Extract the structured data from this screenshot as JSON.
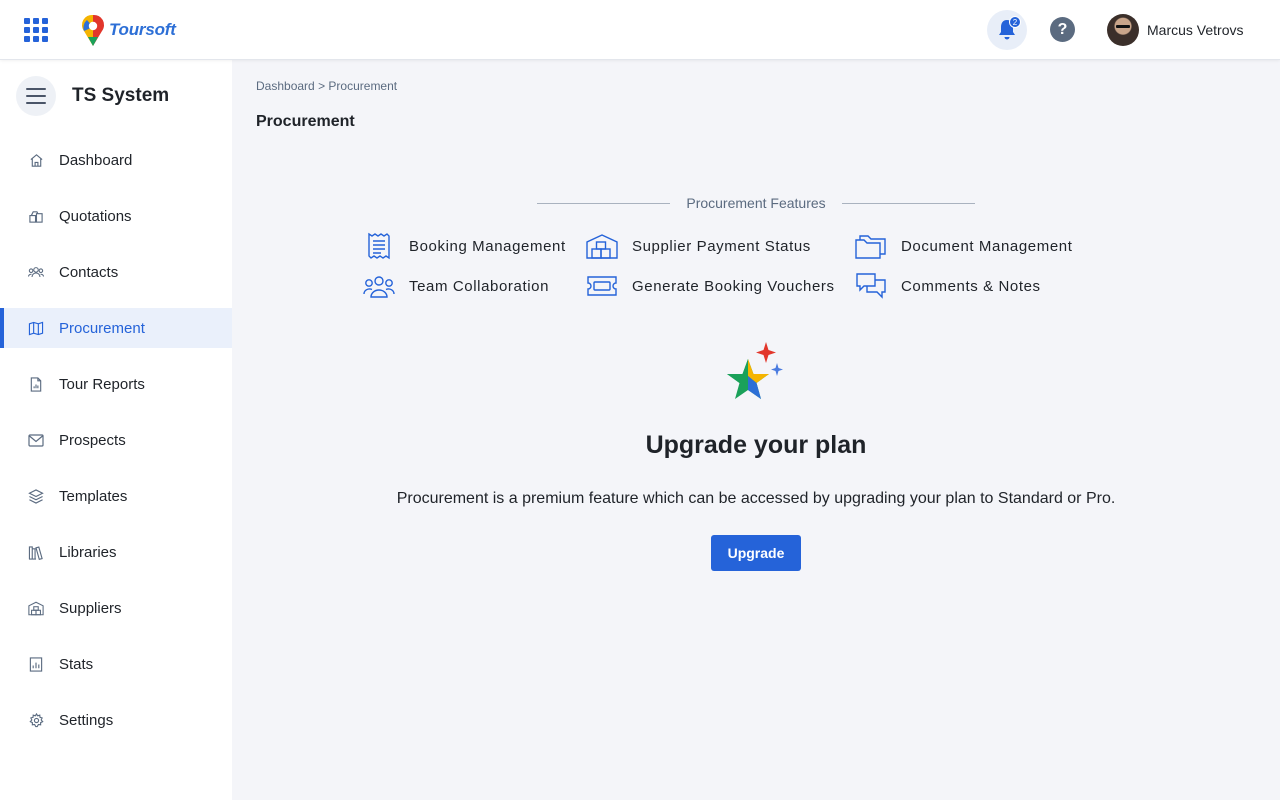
{
  "app": {
    "logo_text": "Toursoft",
    "apps_icon": "grid-icon",
    "brand_color": "#2563d9"
  },
  "topbar": {
    "notifications_count": "2",
    "help_label": "?",
    "user_name": "Marcus Vetrovs"
  },
  "sidebar": {
    "title": "TS System",
    "items": [
      {
        "label": "Dashboard",
        "icon": "home-icon"
      },
      {
        "label": "Quotations",
        "icon": "quotations-icon"
      },
      {
        "label": "Contacts",
        "icon": "contacts-icon"
      },
      {
        "label": "Procurement",
        "icon": "map-icon",
        "active": true
      },
      {
        "label": "Tour Reports",
        "icon": "report-icon"
      },
      {
        "label": "Prospects",
        "icon": "mail-icon"
      },
      {
        "label": "Templates",
        "icon": "layers-icon"
      },
      {
        "label": "Libraries",
        "icon": "books-icon"
      },
      {
        "label": "Suppliers",
        "icon": "warehouse-icon"
      },
      {
        "label": "Stats",
        "icon": "stats-icon"
      },
      {
        "label": "Settings",
        "icon": "gear-icon"
      }
    ]
  },
  "main": {
    "breadcrumb": {
      "root": "Dashboard",
      "separator": ">",
      "current": "Procurement"
    },
    "title": "Procurement",
    "features_heading": "Procurement Features",
    "features": [
      {
        "label": "Booking Management",
        "icon": "receipt-icon"
      },
      {
        "label": "Supplier Payment Status",
        "icon": "warehouse-icon"
      },
      {
        "label": "Document Management",
        "icon": "folders-icon"
      },
      {
        "label": "Team Collaboration",
        "icon": "team-icon"
      },
      {
        "label": "Generate Booking Vouchers",
        "icon": "ticket-icon"
      },
      {
        "label": "Comments & Notes",
        "icon": "chat-icon"
      }
    ],
    "upgrade": {
      "title": "Upgrade your plan",
      "description": "Procurement is a premium feature which can be accessed by upgrading your plan to Standard or Pro.",
      "button_label": "Upgrade"
    }
  }
}
